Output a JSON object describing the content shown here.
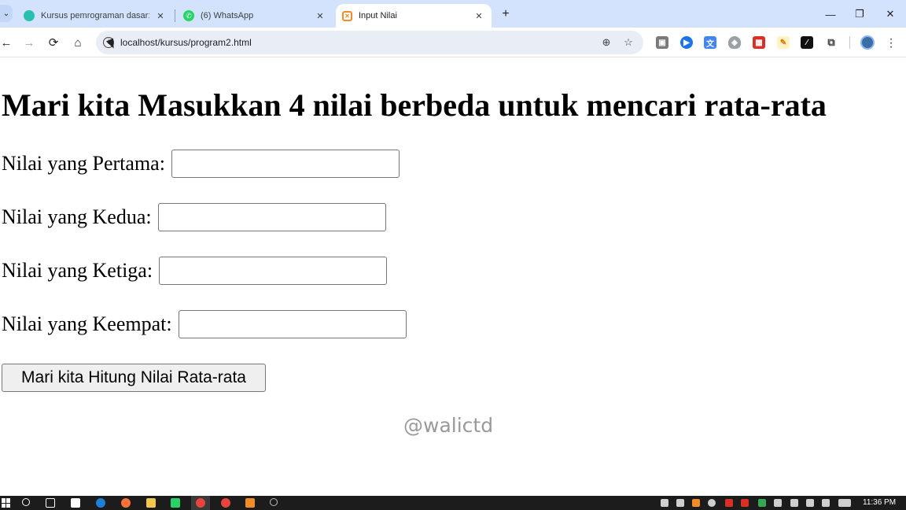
{
  "browser": {
    "tabs": [
      {
        "title": "Kursus pemrograman dasar: Pe",
        "icon": "course-favicon",
        "active": false
      },
      {
        "title": "(6) WhatsApp",
        "icon": "whatsapp-favicon",
        "active": false
      },
      {
        "title": "Input Nilai",
        "icon": "xampp-favicon",
        "active": true
      }
    ],
    "new_tab_label": "+",
    "address": "localhost/kursus/program2.html",
    "window_controls": {
      "minimize": "—",
      "restore": "❐",
      "close": "✕"
    }
  },
  "page": {
    "title": "Mari kita Masukkan 4 nilai berbeda untuk mencari rata-rata",
    "fields": [
      {
        "label": "Nilai yang Pertama:",
        "value": ""
      },
      {
        "label": "Nilai yang Kedua:",
        "value": ""
      },
      {
        "label": "Nilai yang Ketiga:",
        "value": ""
      },
      {
        "label": "Nilai yang Keempat:",
        "value": ""
      }
    ],
    "submit_label": "Mari kita Hitung Nilai Rata-rata",
    "watermark": "@walictd"
  },
  "taskbar": {
    "clock": "11:36 PM"
  },
  "colors": {
    "tabstrip": "#d3e3fd",
    "omnibox": "#e9eef6",
    "taskbar": "#1c1c1c"
  }
}
